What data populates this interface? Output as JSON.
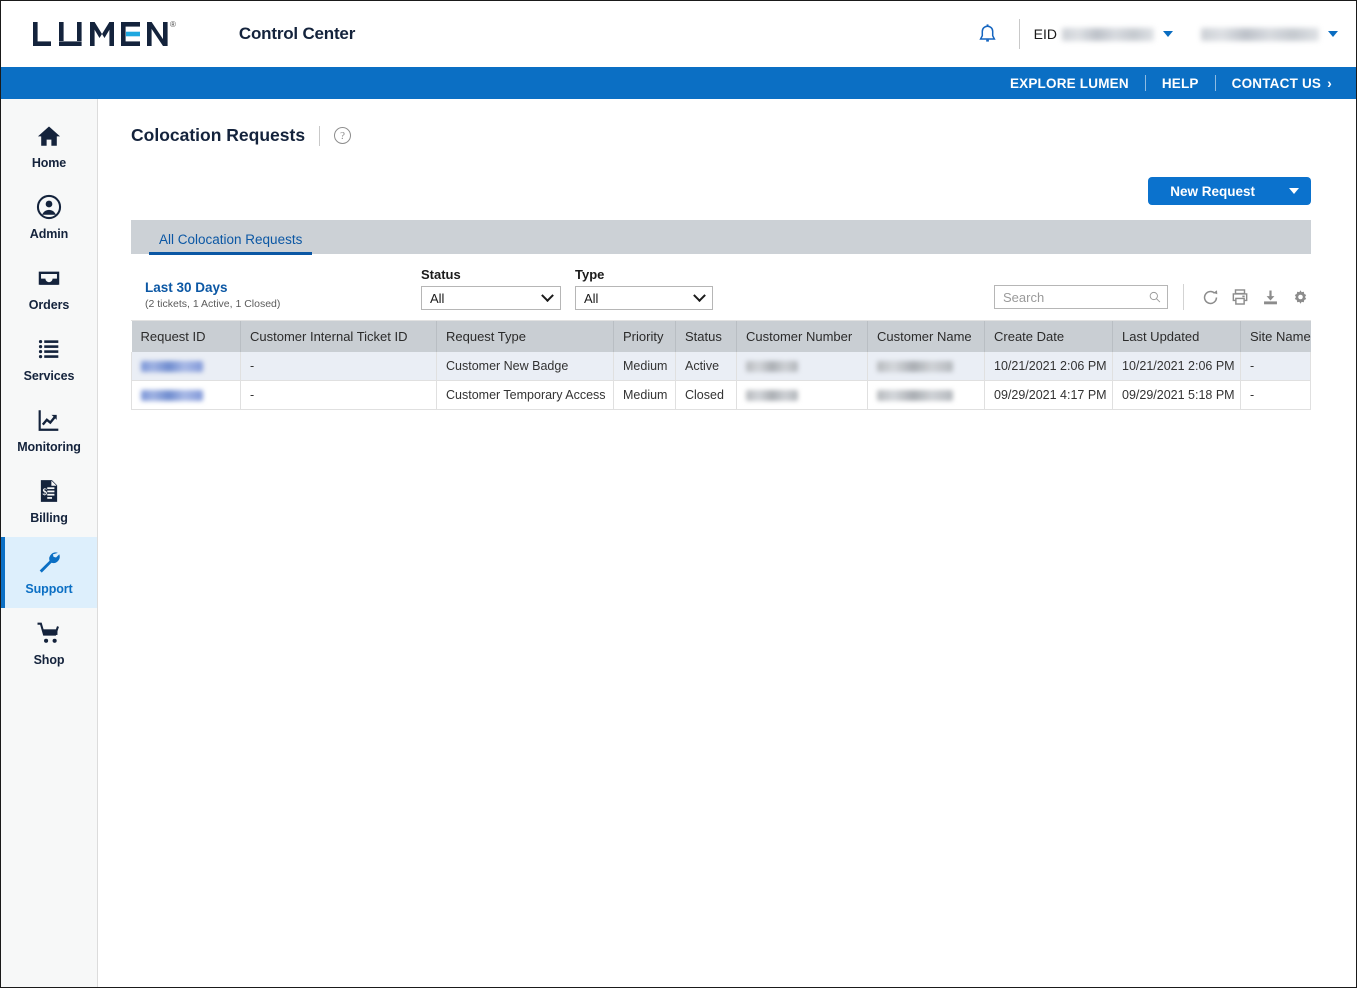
{
  "header": {
    "logo_text": "LUMEN",
    "logo_registered": "®",
    "app_title": "Control Center",
    "bell_icon": "bell-icon",
    "eid_label": "EID",
    "eid_value_redacted": true,
    "account_value_redacted": true
  },
  "bluebar": {
    "explore": "EXPLORE LUMEN",
    "help": "HELP",
    "contact": "CONTACT US",
    "contact_chevron": "›"
  },
  "sidebar": {
    "items": [
      {
        "label": "Home",
        "icon": "home-icon",
        "active": false
      },
      {
        "label": "Admin",
        "icon": "user-circle-icon",
        "active": false
      },
      {
        "label": "Orders",
        "icon": "inbox-tray-icon",
        "active": false
      },
      {
        "label": "Services",
        "icon": "list-icon",
        "active": false
      },
      {
        "label": "Monitoring",
        "icon": "chart-trend-icon",
        "active": false
      },
      {
        "label": "Billing",
        "icon": "invoice-icon",
        "active": false
      },
      {
        "label": "Support",
        "icon": "wrench-icon",
        "active": true
      },
      {
        "label": "Shop",
        "icon": "shopping-cart-icon",
        "active": false
      }
    ]
  },
  "main": {
    "page_title": "Colocation Requests",
    "help_icon_glyph": "?",
    "new_request_label": "New Request",
    "new_request_caret": "caret-down-icon",
    "tabs": [
      {
        "label": "All Colocation Requests",
        "active": true
      }
    ],
    "filters": {
      "range_title": "Last 30 Days",
      "range_sub": "(2 tickets, 1 Active, 1 Closed)",
      "status_label": "Status",
      "status_value": "All",
      "type_label": "Type",
      "type_value": "All",
      "search_placeholder": "Search",
      "search_value": "",
      "tools": [
        "refresh-icon",
        "print-icon",
        "download-icon",
        "gear-icon"
      ]
    },
    "table": {
      "columns": [
        "Request ID",
        "Customer Internal Ticket ID",
        "Request Type",
        "Priority",
        "Status",
        "Customer Number",
        "Customer Name",
        "Create Date",
        "Last Updated",
        "Site Name"
      ],
      "rows": [
        {
          "request_id": "",
          "internal_ticket_id": "-",
          "request_type": "Customer New Badge",
          "priority": "Medium",
          "status": "Active",
          "customer_number": "",
          "customer_name": "",
          "create_date": "10/21/2021 2:06 PM",
          "last_updated": "10/21/2021 2:06 PM",
          "site_name": "-"
        },
        {
          "request_id": "",
          "internal_ticket_id": "-",
          "request_type": "Customer Temporary Access",
          "priority": "Medium",
          "status": "Closed",
          "customer_number": "",
          "customer_name": "",
          "create_date": "09/29/2021 4:17 PM",
          "last_updated": "09/29/2021 5:18 PM",
          "site_name": "-"
        }
      ]
    }
  },
  "colors": {
    "brand_blue": "#0b6fc4",
    "logo_accent": "#1fa8e0",
    "button_blue": "#0b72cd",
    "tab_strip_gray": "#ccd1d6",
    "table_header_gray": "#c9ced3",
    "row_alt_blue": "#eaeef5",
    "active_nav_bg": "#ddeffc"
  }
}
